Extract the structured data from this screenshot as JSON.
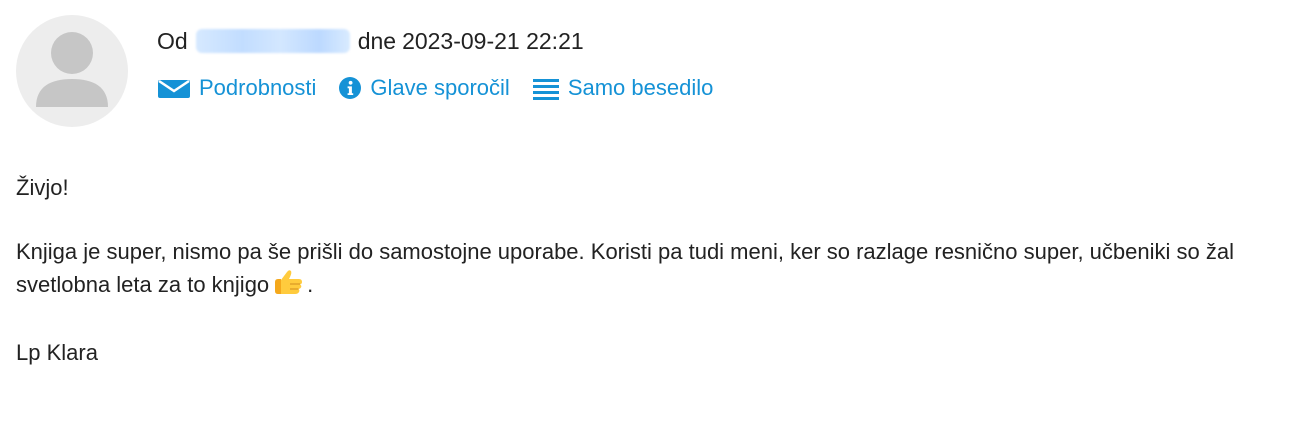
{
  "header": {
    "from_label": "Od",
    "date_label": "dne",
    "datetime": "2023-09-21 22:21"
  },
  "links": [
    {
      "label": "Podrobnosti",
      "icon": "envelope-icon"
    },
    {
      "label": "Glave sporočil",
      "icon": "info-icon"
    },
    {
      "label": "Samo besedilo",
      "icon": "list-lines-icon"
    }
  ],
  "message": {
    "greeting": "Živjo!",
    "paragraph_part1": "Knjiga je super, nismo pa še prišli do samostojne uporabe. Koristi pa tudi meni, ker so razlage resnično super, učbeniki so žal svetlobna leta za to knjigo",
    "paragraph_emoji": "thumbs-up",
    "paragraph_end": ".",
    "signature": "Lp Klara"
  },
  "colors": {
    "link": "#1592d6",
    "text": "#222222",
    "avatar_bg": "#ededed",
    "avatar_fg": "#c6c6c6"
  }
}
